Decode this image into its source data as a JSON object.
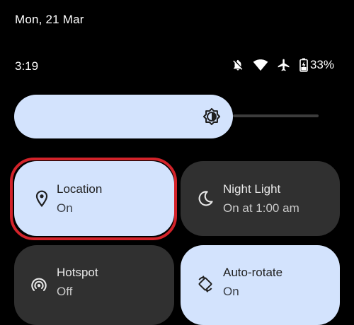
{
  "header": {
    "date": "Mon, 21 Mar",
    "time": "3:19",
    "battery_percent": "33%"
  },
  "status_icons": [
    "notifications-off-icon",
    "wifi-icon",
    "airplane-mode-icon",
    "battery-charging-icon"
  ],
  "brightness": {
    "icon": "brightness-icon",
    "level": 0.67
  },
  "tiles": [
    {
      "title": "Location",
      "subtitle": "On",
      "state": "on",
      "icon": "location-pin-icon"
    },
    {
      "title": "Night Light",
      "subtitle": "On at 1:00 am",
      "state": "off",
      "icon": "moon-icon"
    },
    {
      "title": "Hotspot",
      "subtitle": "Off",
      "state": "off",
      "icon": "hotspot-icon"
    },
    {
      "title": "Auto-rotate",
      "subtitle": "On",
      "state": "on",
      "icon": "auto-rotate-icon"
    }
  ],
  "colors": {
    "tile_on": "#d3e3fd",
    "tile_off": "#303030",
    "highlight": "#d3232a"
  }
}
